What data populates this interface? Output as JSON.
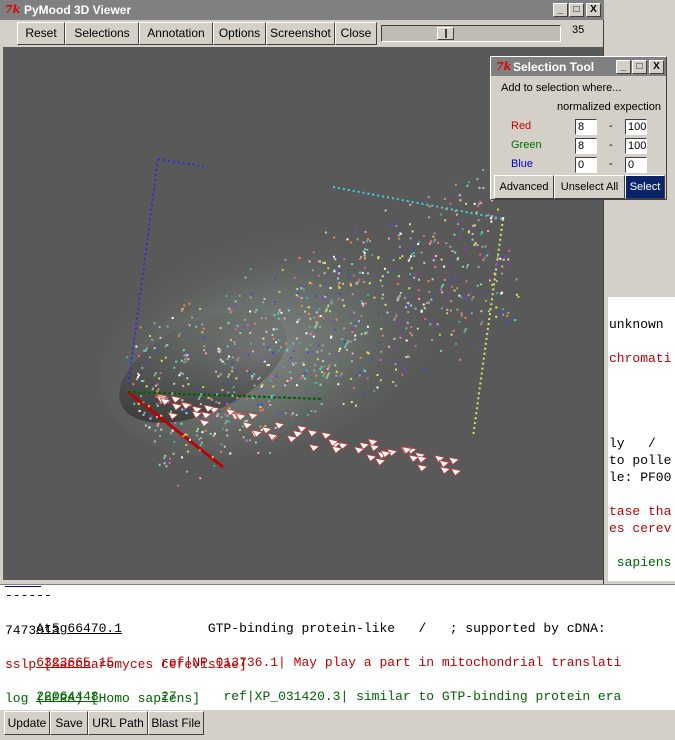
{
  "viewer": {
    "title": "PyMood 3D Viewer",
    "toolbar": [
      "Reset",
      "Selections",
      "Annotation",
      "Options",
      "Screenshot",
      "Close"
    ],
    "slider_value": "35",
    "slider_fraction": 0.35,
    "window_buttons": [
      "_",
      "□",
      "X"
    ]
  },
  "selection_tool": {
    "title": "Selection Tool",
    "prompt": "Add to selection where...",
    "column_header": "normalized expection",
    "rows": [
      {
        "label": "Red",
        "color": "#cc0000",
        "min": "8",
        "max": "100"
      },
      {
        "label": "Green",
        "color": "#007000",
        "min": "8",
        "max": "100"
      },
      {
        "label": "Blue",
        "color": "#0000cc",
        "min": "0",
        "max": "0"
      }
    ],
    "dash": "-",
    "buttons": [
      "Advanced",
      "Unselect All",
      "Select"
    ]
  },
  "right_panel": {
    "lines": [
      {
        "text": "unknown",
        "color": "#000000"
      },
      {
        "text": "chromati",
        "color": "#c00000"
      },
      {
        "text": "ly   /",
        "color": "#000000"
      },
      {
        "text": "to polle",
        "color": "#000000"
      },
      {
        "text": "le: PF00",
        "color": "#000000"
      },
      {
        "text": "tase tha",
        "color": "#c00000"
      },
      {
        "text": "es cerev",
        "color": "#c00000"
      },
      {
        "text": " sapiens",
        "color": "#006400"
      }
    ]
  },
  "results": {
    "separator": "------",
    "entry1_id": "At5g66470.1",
    "entry1_desc": "           GTP-binding protein-like   /   ; supported by cDNA:",
    "entry1_num": "7473913",
    "entry2_id": "6323665",
    "entry2_rest": " 15      ref|NP_013736.1| May play a part in mitochondrial translati",
    "entry2_cont": "sslp [Saccharomyces cerevisiae]",
    "entry3_id": "22064448",
    "entry3_rest": "        27      ref|XP_031420.3| similar to GTP-binding protein era",
    "entry3_cont": "log (hERA) [Homo sapiens]"
  },
  "bottom_buttons": [
    "Update",
    "Save",
    "URL Path",
    "Blast File"
  ],
  "colors": {
    "canvas": "#595959",
    "select_active": "#0a246a",
    "titlebar": "#808080"
  }
}
